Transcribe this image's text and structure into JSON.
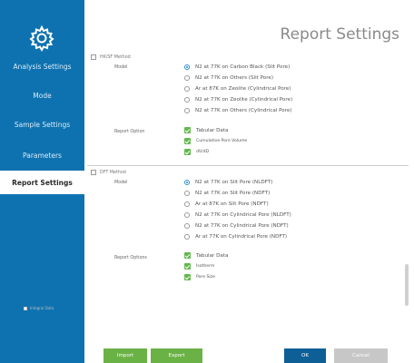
{
  "sidebar": {
    "logo_icon": "gear-icon",
    "items": [
      {
        "label": "Analysis Settings",
        "active": false
      },
      {
        "label": "Mode",
        "active": false
      },
      {
        "label": "Sample Settings",
        "active": false
      },
      {
        "label": "Parameters",
        "active": false
      },
      {
        "label": "Report Settings",
        "active": true
      }
    ]
  },
  "header": {
    "title": "Report Settings"
  },
  "hk": {
    "method_label": "HK/SF Method",
    "model_label": "Model",
    "models": [
      "N2 at 77K on Carbon Black (Slit Pore)",
      "N2 at 77K on Others (Slit Pore)",
      "Ar at 87K on Zeolite (Cylindrical Pore)",
      "N2 at 77K on Zeolite (Cylindrical Pore)",
      "N2 at 77K on Others (Cylindrical Pore)"
    ],
    "selected_model_index": 0,
    "report_label": "Report Option",
    "options": [
      "Tabular Data",
      "Cumulative Pore Volume",
      "dV/dD"
    ]
  },
  "dft": {
    "method_label": "DFT Method",
    "model_label": "Model",
    "models": [
      "N2 at 77K on Slit Pore (NLDFT)",
      "N2 at 77K on Slit Pore (NDFT)",
      "Ar at 87K on Slit Pore (NDFT)",
      "N2 at 77K on Cylindrical Pore (NLDFT)",
      "N2 at 77K on Cylindrical Pore (NDFT)",
      "Ar at 77K on Cylindrical Pore (NDFT)"
    ],
    "selected_model_index": 0,
    "report_label": "Report Options",
    "options": [
      "Tabular Data",
      "Isotherm",
      "Pore Size"
    ]
  },
  "faded_label": "Integral Data",
  "buttons": {
    "import": "Import",
    "export": "Export",
    "ok": "OK",
    "cancel": "Cancel"
  },
  "colors": {
    "sidebar": "#0f72b0",
    "green": "#6ab245",
    "ok": "#0f5f97",
    "cancel": "#c7c7c7"
  }
}
